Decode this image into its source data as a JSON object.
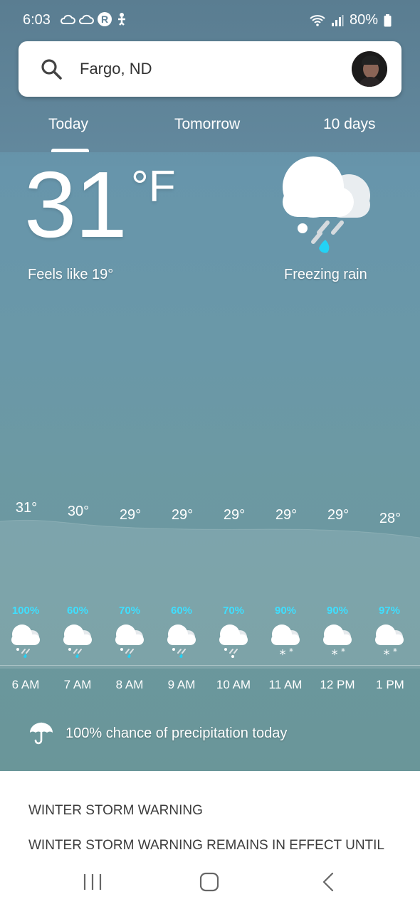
{
  "status_bar": {
    "time": "6:03",
    "battery": "80%"
  },
  "search": {
    "location": "Fargo, ND"
  },
  "tabs": [
    {
      "label": "Today",
      "selected": true
    },
    {
      "label": "Tomorrow",
      "selected": false
    },
    {
      "label": "10 days",
      "selected": false
    }
  ],
  "current": {
    "temperature": "31",
    "unit": "°F",
    "feels_like": "Feels like 19°",
    "condition": "Freezing rain",
    "condition_icon": "freezing-rain-icon"
  },
  "hourly": [
    {
      "time": "6 AM",
      "temp": "31°",
      "precip": "100%",
      "icon": "freezing-rain-icon"
    },
    {
      "time": "7 AM",
      "temp": "30°",
      "precip": "60%",
      "icon": "freezing-rain-icon"
    },
    {
      "time": "8 AM",
      "temp": "29°",
      "precip": "70%",
      "icon": "freezing-rain-icon"
    },
    {
      "time": "9 AM",
      "temp": "29°",
      "precip": "60%",
      "icon": "freezing-rain-icon"
    },
    {
      "time": "10 AM",
      "temp": "29°",
      "precip": "70%",
      "icon": "freezing-rain-icon"
    },
    {
      "time": "11 AM",
      "temp": "29°",
      "precip": "90%",
      "icon": "snow-icon"
    },
    {
      "time": "12 PM",
      "temp": "29°",
      "precip": "90%",
      "icon": "snow-icon"
    },
    {
      "time": "1 PM",
      "temp": "28°",
      "precip": "97%",
      "icon": "snow-icon"
    }
  ],
  "precip_summary": "100% chance of precipitation today",
  "warning": {
    "title": "WINTER STORM WARNING",
    "body": "WINTER STORM WARNING REMAINS IN EFFECT UNTIL"
  },
  "colors": {
    "precip_accent": "#3fdfff",
    "sky_top": "#5a7d91",
    "sky_mid": "#6a98a8"
  }
}
